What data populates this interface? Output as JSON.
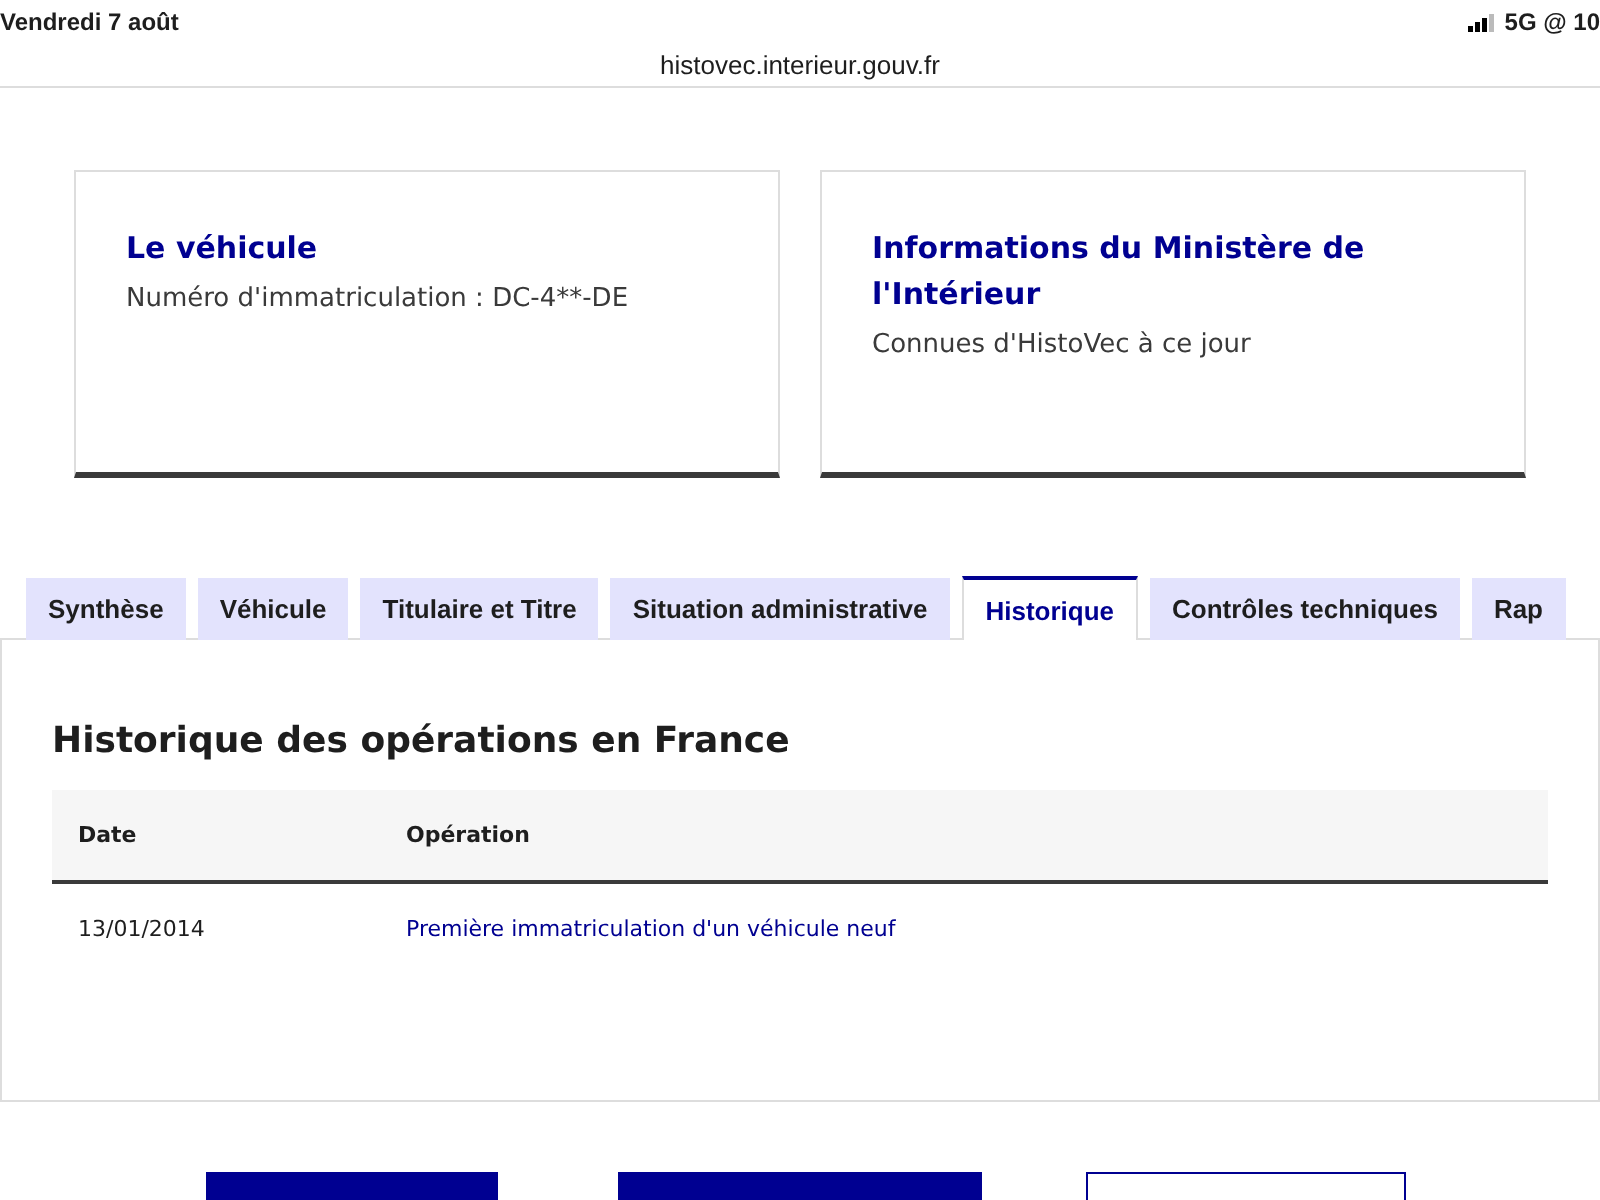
{
  "status_bar": {
    "date": "Vendredi 7 août",
    "network": "5G @ 10"
  },
  "address_bar": {
    "url": "histovec.interieur.gouv.fr"
  },
  "cards": [
    {
      "title": "Le véhicule",
      "subtitle": "Numéro d'immatriculation : DC-4**-DE"
    },
    {
      "title": "Informations du Ministère de l'Intérieur",
      "subtitle": "Connues d'HistoVec à ce jour"
    }
  ],
  "tabs": [
    {
      "label": "Synthèse",
      "selected": false
    },
    {
      "label": "Véhicule",
      "selected": false
    },
    {
      "label": "Titulaire et Titre",
      "selected": false
    },
    {
      "label": "Situation administrative",
      "selected": false
    },
    {
      "label": "Historique",
      "selected": true
    },
    {
      "label": "Contrôles techniques",
      "selected": false
    },
    {
      "label": "Rap",
      "selected": false
    }
  ],
  "panel": {
    "title": "Historique des opérations en France",
    "table": {
      "columns": [
        "Date",
        "Opération"
      ],
      "rows": [
        [
          "13/01/2014",
          "Première immatriculation d'un véhicule neuf"
        ]
      ]
    }
  },
  "bottom_buttons": [
    {
      "kind": "filled"
    },
    {
      "kind": "filled"
    },
    {
      "kind": "outline"
    }
  ]
}
